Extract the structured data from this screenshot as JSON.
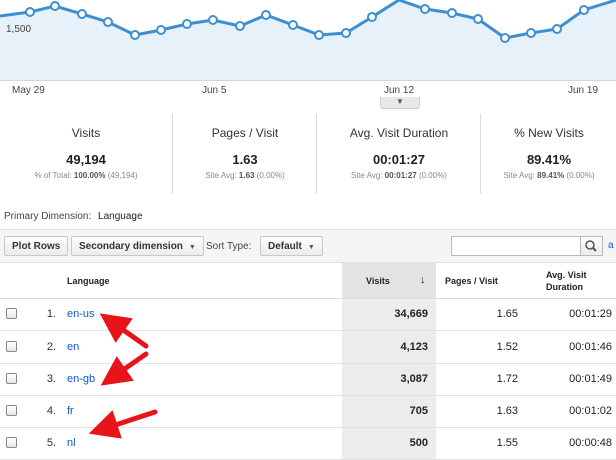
{
  "chart": {
    "y_tick": "1,500",
    "x_ticks": [
      "May 29",
      "Jun 5",
      "Jun 12",
      "Jun 19"
    ],
    "line_color": "#3e8fd0",
    "fill_color": "#e6f1fa"
  },
  "scorecards": [
    {
      "label": "Visits",
      "value": "49,194",
      "sub_prefix": "% of Total:",
      "sub_bold": "100.00%",
      "sub_suffix": "(49,194)"
    },
    {
      "label": "Pages / Visit",
      "value": "1.63",
      "sub_prefix": "Site Avg:",
      "sub_bold": "1.63",
      "sub_suffix": "(0.00%)"
    },
    {
      "label": "Avg. Visit Duration",
      "value": "00:01:27",
      "sub_prefix": "Site Avg:",
      "sub_bold": "00:01:27",
      "sub_suffix": "(0.00%)"
    },
    {
      "label": "% New Visits",
      "value": "89.41%",
      "sub_prefix": "Site Avg:",
      "sub_bold": "89.41%",
      "sub_suffix": "(0.00%)"
    }
  ],
  "primary_dimension": {
    "label": "Primary Dimension:",
    "value": "Language"
  },
  "toolbar": {
    "plot_rows": "Plot Rows",
    "secondary_dimension": "Secondary dimension",
    "sort_type_label": "Sort Type:",
    "sort_type_value": "Default",
    "search_placeholder": "",
    "advanced_link": "a"
  },
  "table": {
    "headers": {
      "language": "Language",
      "visits": "Visits",
      "pages": "Pages / Visit",
      "duration": "Avg. Visit Duration"
    },
    "rows": [
      {
        "index": "1.",
        "language": "en-us",
        "visits": "34,669",
        "pages": "1.65",
        "duration": "00:01:29"
      },
      {
        "index": "2.",
        "language": "en",
        "visits": "4,123",
        "pages": "1.52",
        "duration": "00:01:46"
      },
      {
        "index": "3.",
        "language": "en-gb",
        "visits": "3,087",
        "pages": "1.72",
        "duration": "00:01:49"
      },
      {
        "index": "4.",
        "language": "fr",
        "visits": "705",
        "pages": "1.63",
        "duration": "00:01:02"
      },
      {
        "index": "5.",
        "language": "nl",
        "visits": "500",
        "pages": "1.55",
        "duration": "00:00:48"
      }
    ]
  },
  "annotation_color": "#e8141b"
}
